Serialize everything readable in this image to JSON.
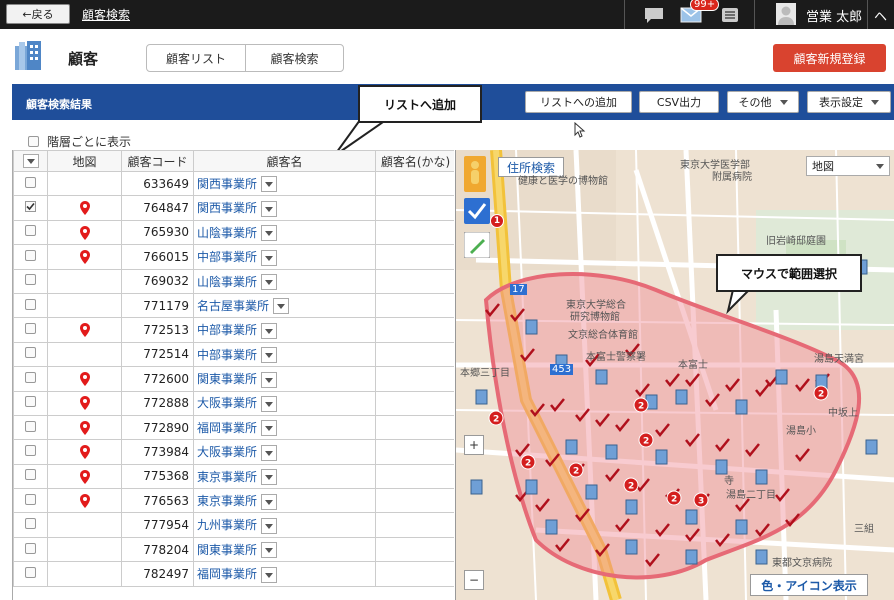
{
  "topbar": {
    "back_label": "←戻る",
    "title": "顧客検索",
    "badge": "99+",
    "user_name": "営業 太郎",
    "edge_text": "ヘ"
  },
  "header": {
    "title": "顧客",
    "tabs": [
      {
        "label": "顧客リスト"
      },
      {
        "label": "顧客検索"
      }
    ],
    "new_button": "顧客新規登録"
  },
  "results_bar": {
    "title": "顧客検索結果",
    "buttons": {
      "add_to_list": "リストへの追加",
      "csv": "CSV出力",
      "other": "その他",
      "display": "表示設定"
    }
  },
  "callouts": {
    "list_add": "リストへ追加",
    "range_select": "マウスで範囲選択"
  },
  "group_display": "階層ごとに表示",
  "table": {
    "headers": {
      "map": "地図",
      "code": "顧客コード",
      "name": "顧客名",
      "kana": "顧客名(かな)"
    },
    "rows": [
      {
        "code": "633649",
        "name": "関西事業所",
        "pin": false,
        "checked": false
      },
      {
        "code": "764847",
        "name": "関西事業所",
        "pin": true,
        "checked": true
      },
      {
        "code": "765930",
        "name": "山陰事業所",
        "pin": true,
        "checked": false
      },
      {
        "code": "766015",
        "name": "中部事業所",
        "pin": true,
        "checked": false
      },
      {
        "code": "769032",
        "name": "山陰事業所",
        "pin": false,
        "checked": false
      },
      {
        "code": "771179",
        "name": "名古屋事業所",
        "pin": false,
        "checked": false
      },
      {
        "code": "772513",
        "name": "中部事業所",
        "pin": true,
        "checked": false
      },
      {
        "code": "772514",
        "name": "中部事業所",
        "pin": false,
        "checked": false
      },
      {
        "code": "772600",
        "name": "関東事業所",
        "pin": true,
        "checked": false
      },
      {
        "code": "772888",
        "name": "大阪事業所",
        "pin": true,
        "checked": false
      },
      {
        "code": "772890",
        "name": "福岡事業所",
        "pin": true,
        "checked": false
      },
      {
        "code": "773984",
        "name": "大阪事業所",
        "pin": true,
        "checked": false
      },
      {
        "code": "775368",
        "name": "東京事業所",
        "pin": true,
        "checked": false
      },
      {
        "code": "776563",
        "name": "東京事業所",
        "pin": true,
        "checked": false
      },
      {
        "code": "777954",
        "name": "九州事業所",
        "pin": false,
        "checked": false
      },
      {
        "code": "778204",
        "name": "関東事業所",
        "pin": false,
        "checked": false
      },
      {
        "code": "782497",
        "name": "福岡事業所",
        "pin": false,
        "checked": false
      }
    ]
  },
  "map": {
    "search_button": "住所検索",
    "type_select": "地図",
    "color_icon_button": "色・アイコン表示",
    "zoom_in": "+",
    "zoom_out": "−",
    "labels": {
      "university_hospital": "東京大学医学部",
      "attached_hospital": "附属病院",
      "museum": "健康と医学の博物館",
      "garden": "旧岩崎邸庭園",
      "u_museum_1": "東京大学総合",
      "u_museum_2": "研究博物館",
      "gym": "文京総合体育館",
      "police": "本富士警察署",
      "hongo3": "本郷三丁目",
      "hongo_mae": "本富士",
      "yushima": "湯島天満宮",
      "yushima_sho": "湯島小",
      "yushima2": "湯島二丁目",
      "tenjin": "中坂上",
      "temple": "寺",
      "sanbashi": "三組",
      "bunkyo_hosp": "東都文京病院",
      "road_17": "17",
      "road_453": "453"
    }
  }
}
